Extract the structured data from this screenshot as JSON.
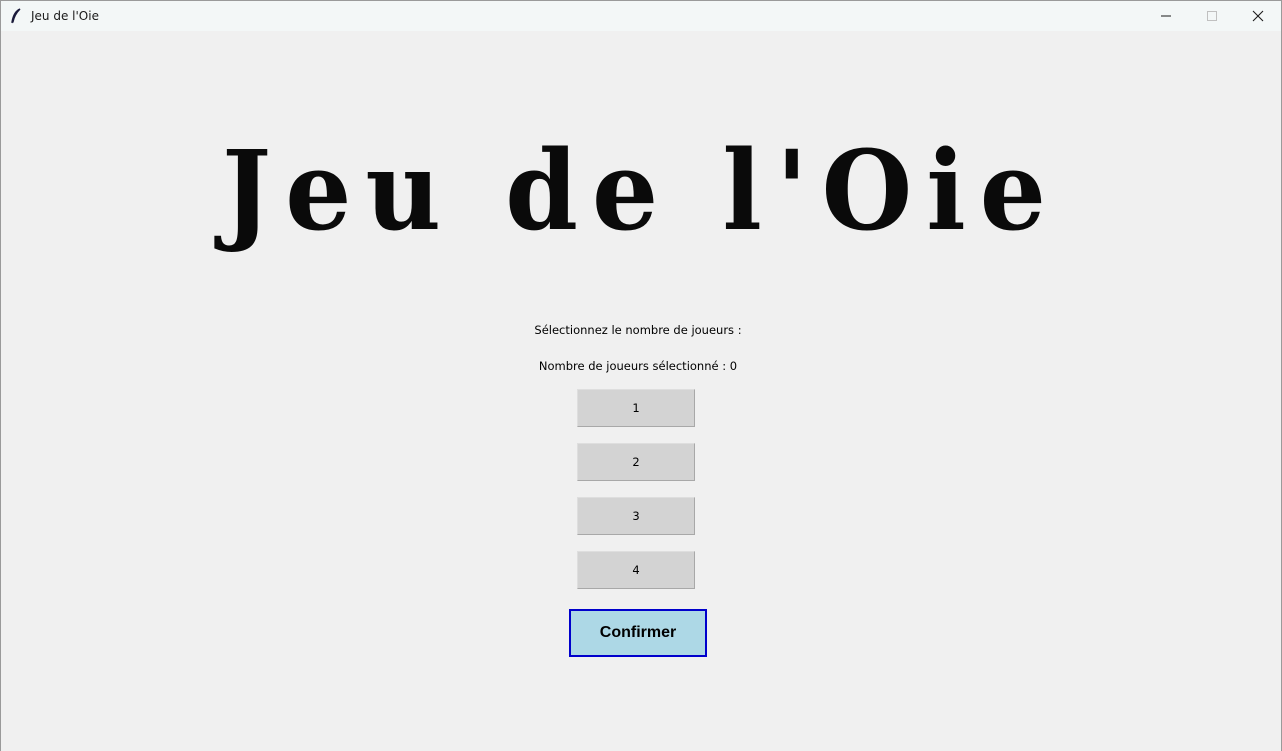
{
  "window": {
    "title": "Jeu de l'Oie",
    "app_icon": "feather-icon",
    "controls": [
      "minimize-icon",
      "maximize-icon",
      "close-icon"
    ]
  },
  "main": {
    "game_title": "Jeu de l'Oie",
    "select_prompt": "Sélectionnez le nombre de joueurs :",
    "selected_count_label": "Nombre de joueurs sélectionné : 0",
    "player_buttons": [
      {
        "label": "1"
      },
      {
        "label": "2"
      },
      {
        "label": "3"
      },
      {
        "label": "4"
      }
    ],
    "confirm_label": "Confirmer"
  },
  "colors": {
    "background": "#f0f0f0",
    "player_button_bg": "#d3d3d3",
    "confirm_bg": "#add8e6",
    "confirm_border": "#0000cc"
  }
}
